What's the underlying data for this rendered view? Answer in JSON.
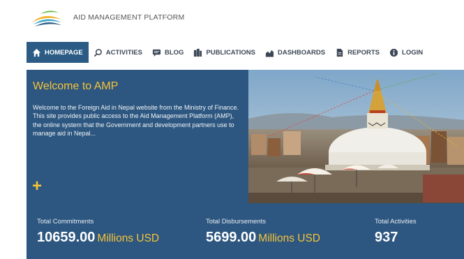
{
  "brand": {
    "name": "AID MANAGEMENT PLATFORM"
  },
  "nav": {
    "items": [
      {
        "label": "HOMEPAGE",
        "icon": "home-icon",
        "active": true
      },
      {
        "label": "ACTIVITIES",
        "icon": "search-icon"
      },
      {
        "label": "BLOG",
        "icon": "chat-icon"
      },
      {
        "label": "PUBLICATIONS",
        "icon": "documents-icon"
      },
      {
        "label": "DASHBOARDS",
        "icon": "chart-icon"
      },
      {
        "label": "REPORTS",
        "icon": "report-icon"
      },
      {
        "label": "LOGIN",
        "icon": "info-icon"
      }
    ]
  },
  "hero": {
    "title": "Welcome to AMP",
    "text": "Welcome to the Foreign Aid in Nepal website from the Ministry of Finance. This site provides public access to the Aid Management Platform (AMP), the online system that the Government and development partners use to manage aid in Nepal...",
    "expand_symbol": "+"
  },
  "stats": {
    "commitments": {
      "label": "Total Commitments",
      "value": "10659.00",
      "unit": "Millions USD"
    },
    "disbursements": {
      "label": "Total Disbursements",
      "value": "5699.00",
      "unit": "Millions USD"
    },
    "activities": {
      "label": "Total Activities",
      "value": "937"
    }
  },
  "colors": {
    "primary": "#2d5780",
    "accent": "#f6c338",
    "nav_text": "#3d4856"
  }
}
